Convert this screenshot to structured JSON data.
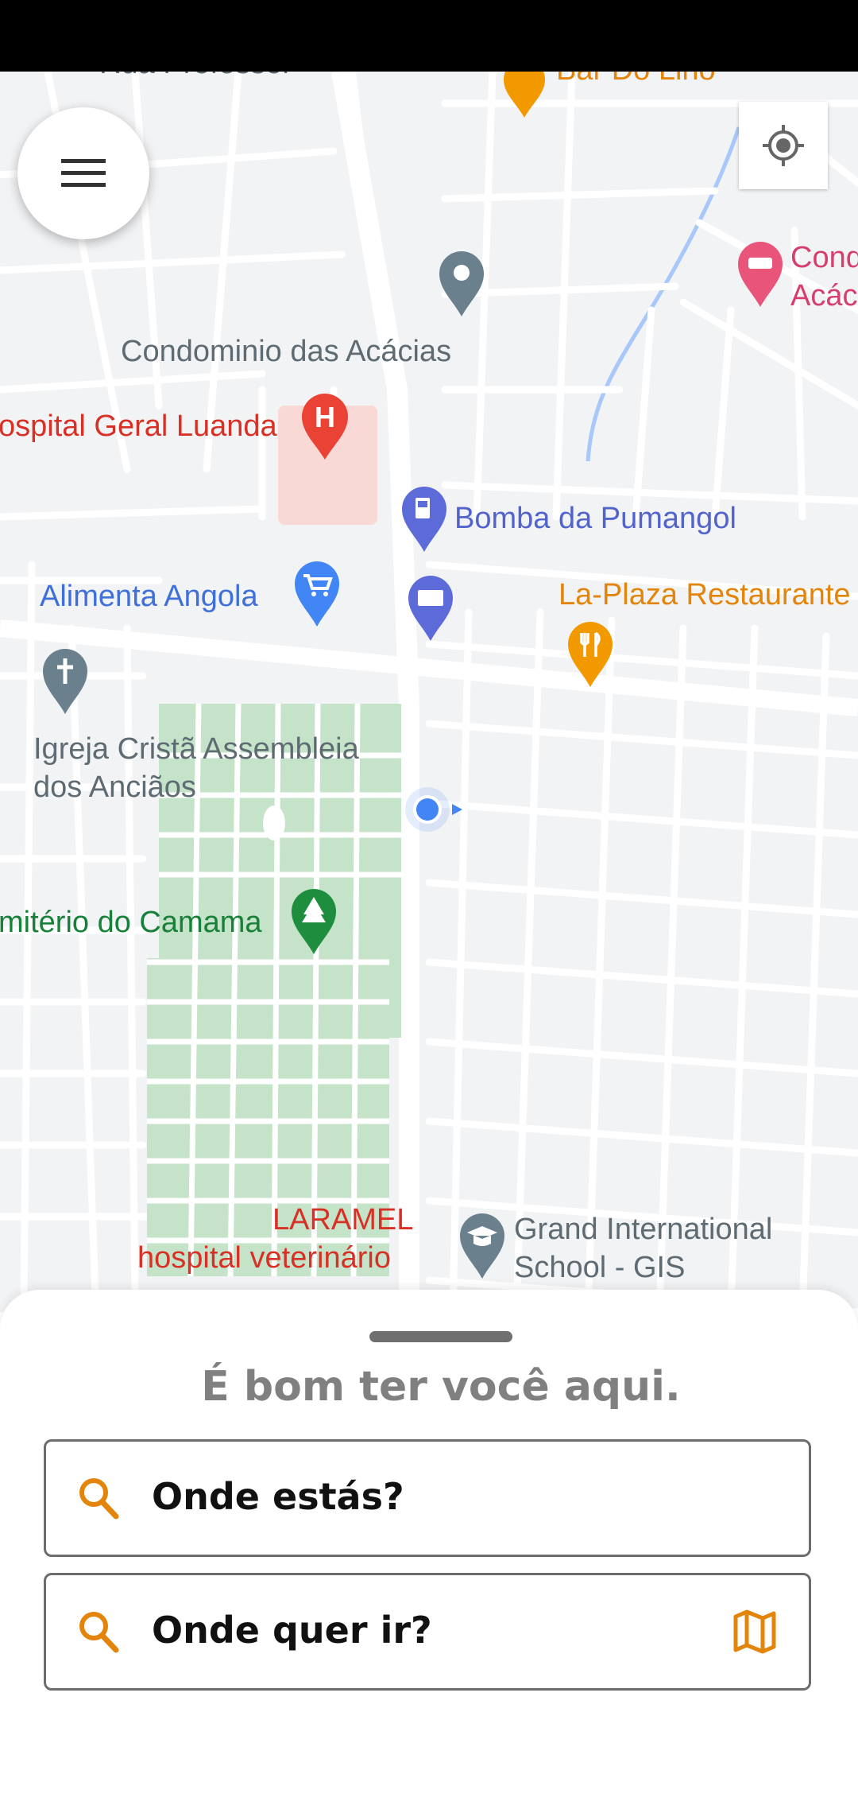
{
  "map": {
    "labels": {
      "top_left_cut": "Rua Professor",
      "bar_do_lino": "Bar Do Lino",
      "cond_right_line1": "Cond",
      "cond_right_line2": "Acác",
      "condominio": "Condominio das Acácias",
      "hospital": "ospital Geral Luanda",
      "bomba": "Bomba da Pumangol",
      "alimenta": "Alimenta Angola",
      "laplaza": "La-Plaza Restaurante",
      "igreja_line1": "Igreja Cristã Assembleia",
      "igreja_line2": "dos Anciãos",
      "cemiterio": "mitério do Camama",
      "laramel_line1": "LARAMEL",
      "laramel_line2": "hospital veterinário",
      "gis_line1": "Grand International",
      "gis_line2": "School - GIS"
    },
    "colors": {
      "road": "#ffffff",
      "block": "#e8eaed",
      "park": "#c4e3c8",
      "hospital_red": "#d93025",
      "poi_blue": "#3f6fd8",
      "poi_orange": "#e3850b",
      "text_gray": "#5f6b72",
      "park_green": "#188038",
      "river": "#a8c7fa",
      "location_dot": "#4285f4"
    }
  },
  "menu_button": {
    "icon": "hamburger-icon"
  },
  "locate_button": {
    "icon": "my-location-icon"
  },
  "sheet": {
    "greeting": "É bom ter você aqui.",
    "origin": {
      "value": "Onde estás?",
      "icon": "search-icon"
    },
    "destination": {
      "value": "Onde quer ir?",
      "icon": "search-icon",
      "trailing_icon": "map-icon"
    },
    "accent_color": "#e3850b"
  }
}
